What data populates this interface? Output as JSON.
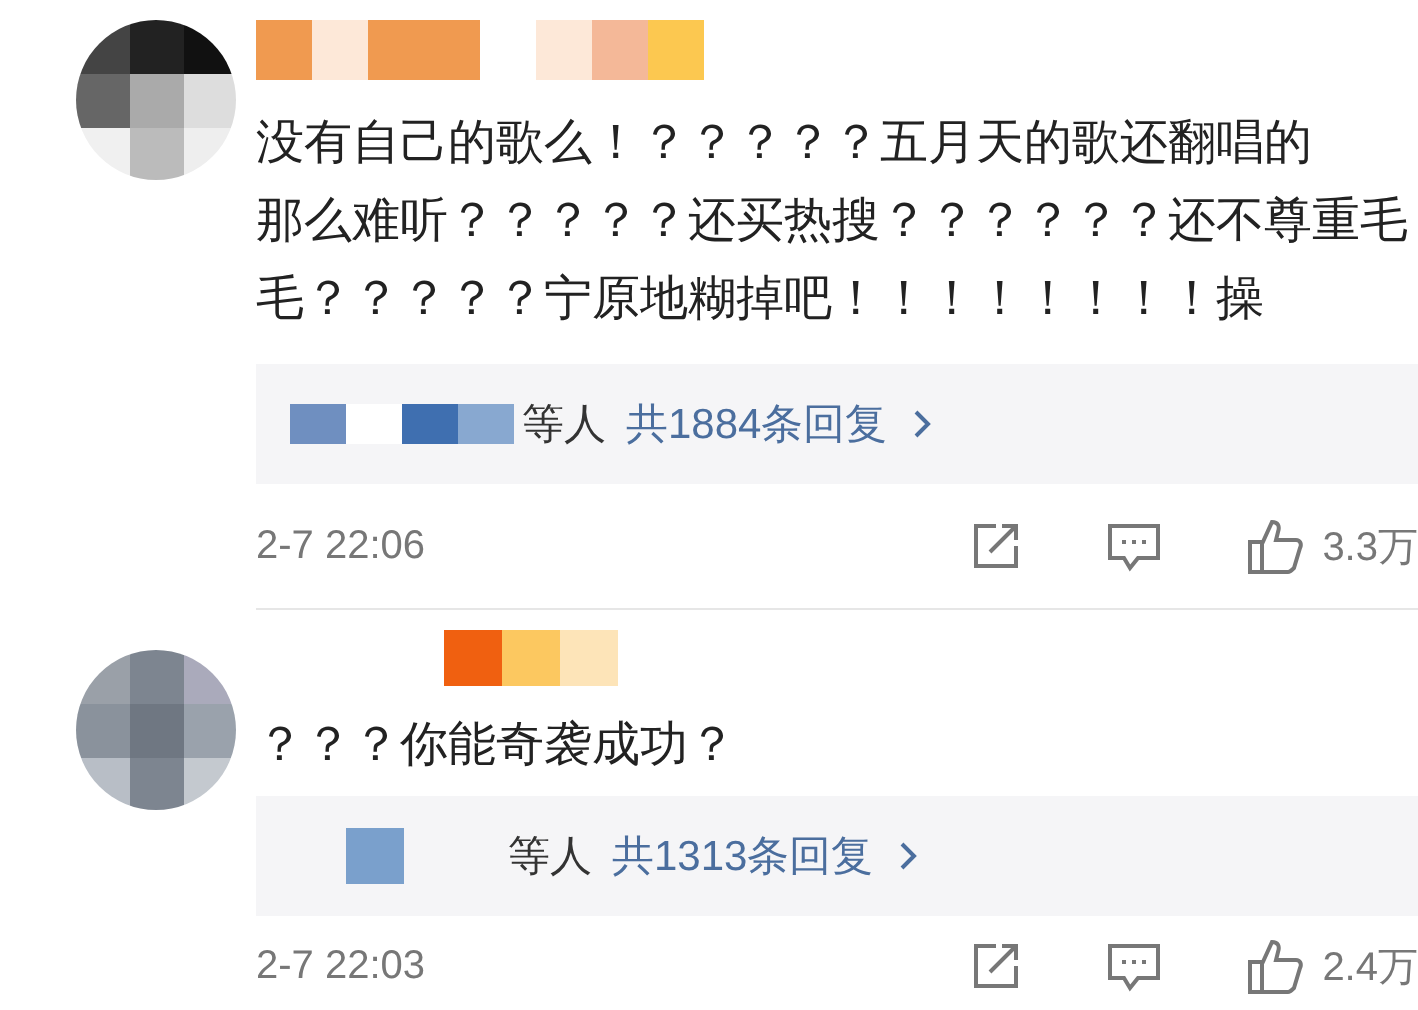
{
  "comments": [
    {
      "lines": [
        "没有自己的歌么！？？？？？五月天的歌还翻唱的",
        "那么难听？？？？？还买热搜？？？？？？还不尊重毛",
        "毛？？？？？宁原地糊掉吧！！！！！！！！操"
      ],
      "replies": {
        "suffix": "等人",
        "link": "共1884条回复"
      },
      "time": "2-7 22:06",
      "likes": "3.3万"
    },
    {
      "lines": [
        "？？？你能奇袭成功？"
      ],
      "replies": {
        "suffix": "等人",
        "link": "共1313条回复"
      },
      "time": "2-7 22:03",
      "likes": "2.4万"
    }
  ]
}
